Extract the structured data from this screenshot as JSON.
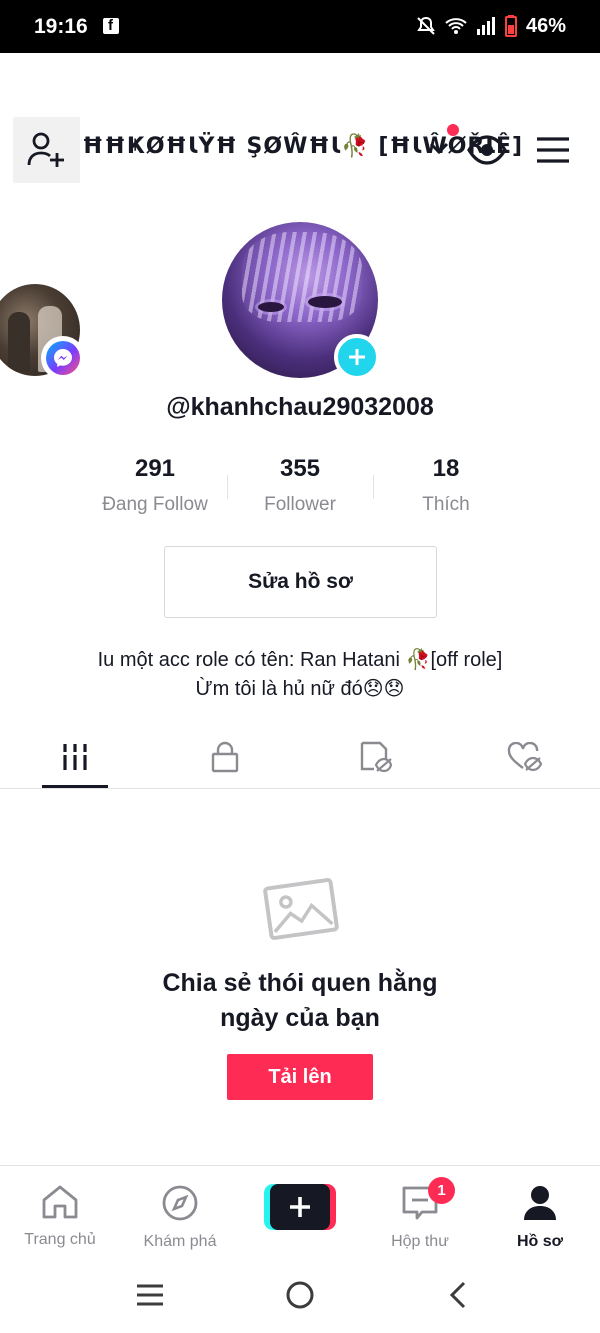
{
  "status_bar": {
    "time": "19:16",
    "battery": "46%"
  },
  "header": {
    "username_title": "ĦĦҜØĦƖΫĦ ŞØŴĦƖ🥀 [ĦƖŴØŘƖÊ]",
    "has_notification_dot": true
  },
  "profile": {
    "handle": "@khanhchau29032008",
    "stats": [
      {
        "value": "291",
        "label": "Đang Follow"
      },
      {
        "value": "355",
        "label": "Follower"
      },
      {
        "value": "18",
        "label": "Thích"
      }
    ],
    "edit_button": "Sửa hồ sơ",
    "bio_line1": "Iu một acc role có tên: Ran Hatani 🥀[off role]",
    "bio_line2": "Ừm tôi là hủ nữ đó😞😞"
  },
  "tabs": [
    {
      "name": "videos",
      "icon": "grid-icon",
      "active": true
    },
    {
      "name": "private",
      "icon": "lock-icon",
      "active": false
    },
    {
      "name": "reposts",
      "icon": "hidden-repost-icon",
      "active": false
    },
    {
      "name": "liked",
      "icon": "hidden-heart-icon",
      "active": false
    }
  ],
  "empty_state": {
    "title_line1": "Chia sẻ thói quen hằng",
    "title_line2": "ngày của bạn",
    "upload_button": "Tải lên"
  },
  "bottom_nav": {
    "items": [
      {
        "label": "Trang chủ",
        "icon": "home-icon"
      },
      {
        "label": "Khám phá",
        "icon": "compass-icon"
      },
      {
        "label": "Hộp thư",
        "icon": "inbox-icon",
        "badge": "1"
      },
      {
        "label": "Hồ sơ",
        "icon": "profile-icon",
        "active": true
      }
    ]
  },
  "colors": {
    "accent": "#fe2c55",
    "cyan": "#20d5ec",
    "text": "#161823",
    "muted": "#8a8b91"
  }
}
